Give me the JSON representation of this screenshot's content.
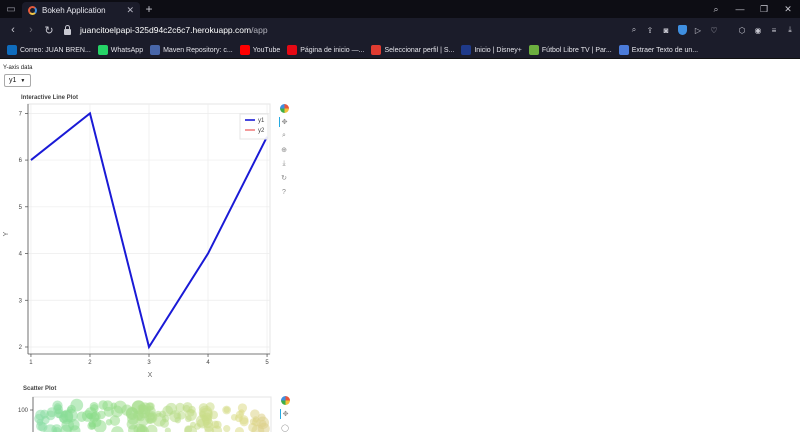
{
  "browser": {
    "tab_title": "Bokeh Application",
    "url_host": "juancitoelpapi-325d94c2c6c7.herokuapp.com",
    "url_path": "/app",
    "bookmarks": [
      {
        "label": "Correo: JUAN BREN...",
        "color": "#0f6cbd"
      },
      {
        "label": "WhatsApp",
        "color": "#25d366"
      },
      {
        "label": "Maven Repository: c...",
        "color": "#4866a8"
      },
      {
        "label": "YouTube",
        "color": "#ff0000"
      },
      {
        "label": "Página de inicio —...",
        "color": "#e50914"
      },
      {
        "label": "Seleccionar perfil | S...",
        "color": "#e03c31"
      },
      {
        "label": "Inicio | Disney+",
        "color": "#1f3a8a"
      },
      {
        "label": "Fútbol Libre TV | Par...",
        "color": "#6cae3f"
      },
      {
        "label": "Extraer Texto de un...",
        "color": "#4b7bd9"
      }
    ]
  },
  "app": {
    "select_label": "Y-axis data",
    "select_value": "y1",
    "line_plot": {
      "title": "Interactive Line Plot"
    },
    "scatter_plot": {
      "title": "Scatter Plot"
    }
  },
  "chart_data": [
    {
      "type": "line",
      "title": "Interactive Line Plot",
      "xlabel": "X",
      "ylabel": "Y",
      "x": [
        1,
        2,
        3,
        4,
        5
      ],
      "series": [
        {
          "name": "y1",
          "values": [
            6,
            7,
            2,
            4,
            6.5
          ],
          "color": "#1a1ad6"
        },
        {
          "name": "y2",
          "values": [],
          "color": "#f08080"
        }
      ],
      "xticks": [
        "1",
        "2",
        "3",
        "4",
        "5"
      ],
      "yticks": [
        "2",
        "3",
        "4",
        "5",
        "6",
        "7"
      ],
      "xlim": [
        0.95,
        5.05
      ],
      "ylim": [
        1.85,
        7.2
      ],
      "grid": true,
      "legend": "top-right"
    },
    {
      "type": "scatter",
      "title": "Scatter Plot",
      "yticks": [
        "100"
      ],
      "grid": true
    }
  ]
}
